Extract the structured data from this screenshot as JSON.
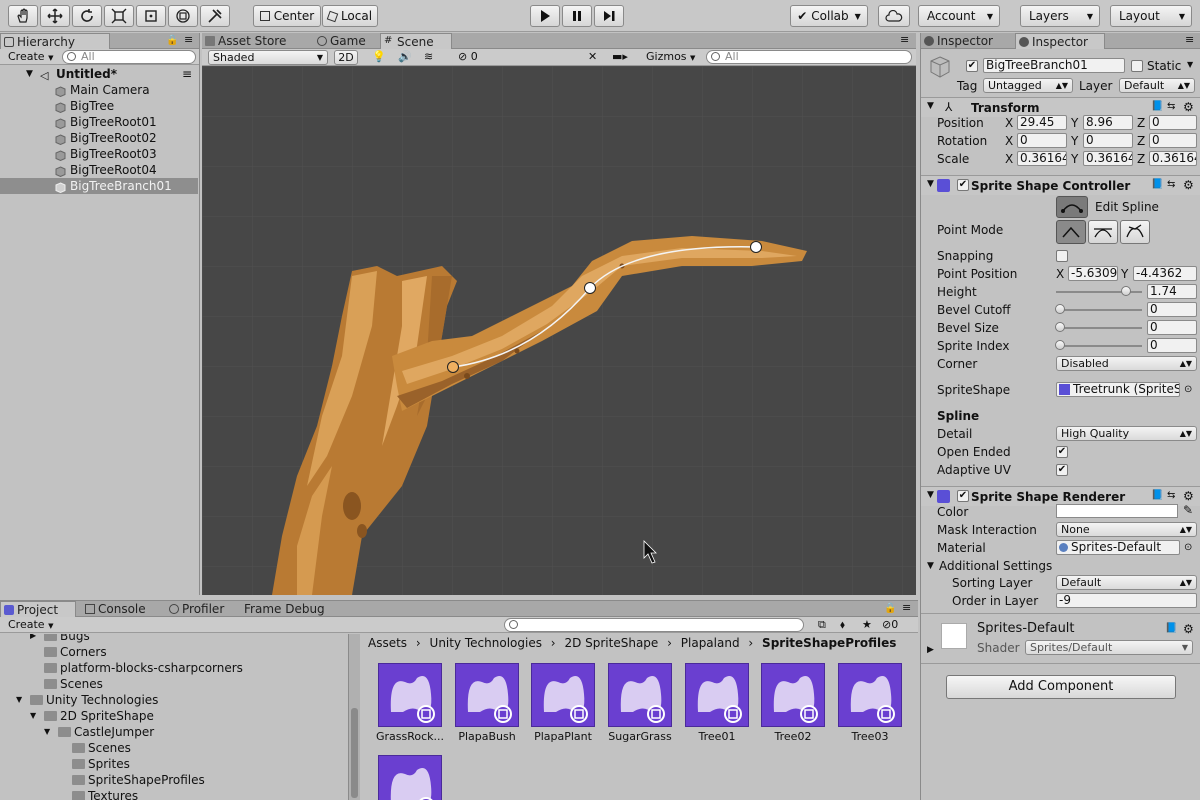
{
  "toolbar": {
    "pivot_label": "Center",
    "space_label": "Local",
    "collab_label": "Collab",
    "account_label": "Account",
    "layers_label": "Layers",
    "layout_label": "Layout"
  },
  "hierarchy": {
    "tab_label": "Hierarchy",
    "create_label": "Create",
    "search_placeholder": "All",
    "scene_name": "Untitled*",
    "items": [
      {
        "label": "Main Camera"
      },
      {
        "label": "BigTree"
      },
      {
        "label": "BigTreeRoot01"
      },
      {
        "label": "BigTreeRoot02"
      },
      {
        "label": "BigTreeRoot03"
      },
      {
        "label": "BigTreeRoot04"
      },
      {
        "label": "BigTreeBranch01"
      }
    ]
  },
  "scene": {
    "tabs": [
      {
        "label": "Asset Store"
      },
      {
        "label": "Game"
      },
      {
        "label": "Scene"
      }
    ],
    "shading_mode": "Shaded",
    "mode_2d": "2D",
    "hidden_count": "0",
    "gizmos_label": "Gizmos",
    "search_placeholder": "All"
  },
  "inspector": {
    "tabs": [
      {
        "label": "Inspector"
      },
      {
        "label": "Inspector"
      }
    ],
    "object_name": "BigTreeBranch01",
    "static_label": "Static",
    "tag_label": "Tag",
    "tag_value": "Untagged",
    "layer_label": "Layer",
    "layer_value": "Default",
    "transform": {
      "title": "Transform",
      "position_label": "Position",
      "rotation_label": "Rotation",
      "scale_label": "Scale",
      "position": {
        "x": "29.45",
        "y": "8.96",
        "z": "0"
      },
      "rotation": {
        "x": "0",
        "y": "0",
        "z": "0"
      },
      "scale": {
        "x": "0.36164",
        "y": "0.36164",
        "z": "0.36164"
      }
    },
    "controller": {
      "title": "Sprite Shape Controller",
      "edit_spline": "Edit Spline",
      "point_mode": "Point Mode",
      "snapping": "Snapping",
      "point_position": "Point Position",
      "point_x": "-5.6309",
      "point_y": "-4.4362",
      "height_label": "Height",
      "height_value": "1.74",
      "bevel_cutoff_label": "Bevel Cutoff",
      "bevel_cutoff_value": "0",
      "bevel_size_label": "Bevel Size",
      "bevel_size_value": "0",
      "sprite_index_label": "Sprite Index",
      "sprite_index_value": "0",
      "corner_label": "Corner",
      "corner_value": "Disabled",
      "spriteshape_label": "SpriteShape",
      "spriteshape_value": "Treetrunk (SpriteS",
      "spline_header": "Spline",
      "detail_label": "Detail",
      "detail_value": "High Quality",
      "open_ended_label": "Open Ended",
      "adaptive_uv_label": "Adaptive UV"
    },
    "renderer": {
      "title": "Sprite Shape Renderer",
      "color_label": "Color",
      "mask_label": "Mask Interaction",
      "mask_value": "None",
      "material_label": "Material",
      "material_value": "Sprites-Default",
      "additional_label": "Additional Settings",
      "sorting_layer_label": "Sorting Layer",
      "sorting_layer_value": "Default",
      "order_label": "Order in Layer",
      "order_value": "-9"
    },
    "material_block": {
      "name": "Sprites-Default",
      "shader_label": "Shader",
      "shader_value": "Sprites/Default"
    },
    "add_component": "Add Component"
  },
  "project": {
    "tabs": [
      {
        "label": "Project"
      },
      {
        "label": "Console"
      },
      {
        "label": "Profiler"
      },
      {
        "label": "Frame Debug"
      }
    ],
    "create_label": "Create",
    "hidden_count": "0",
    "tree": [
      {
        "label": "Bugs"
      },
      {
        "label": "Corners"
      },
      {
        "label": "platform-blocks-csharpcorners"
      },
      {
        "label": "Scenes"
      },
      {
        "label": "Unity Technologies"
      },
      {
        "label": "2D SpriteShape"
      },
      {
        "label": "CastleJumper"
      },
      {
        "label": "Scenes"
      },
      {
        "label": "Sprites"
      },
      {
        "label": "SpriteShapeProfiles"
      },
      {
        "label": "Textures"
      }
    ],
    "breadcrumb": [
      {
        "label": "Assets"
      },
      {
        "label": "Unity Technologies"
      },
      {
        "label": "2D SpriteShape"
      },
      {
        "label": "Plapaland"
      },
      {
        "label": "SpriteShapeProfiles"
      }
    ],
    "assets": [
      {
        "label": "GrassRock..."
      },
      {
        "label": "PlapaBush"
      },
      {
        "label": "PlapaPlant"
      },
      {
        "label": "SugarGrass"
      },
      {
        "label": "Tree01"
      },
      {
        "label": "Tree02"
      },
      {
        "label": "Tree03"
      }
    ]
  },
  "colors": {
    "scene_bg": "#474747",
    "wood": "#c98a3d",
    "asset_purple": "#6a3fd0",
    "selection": "#8e8e8e"
  }
}
